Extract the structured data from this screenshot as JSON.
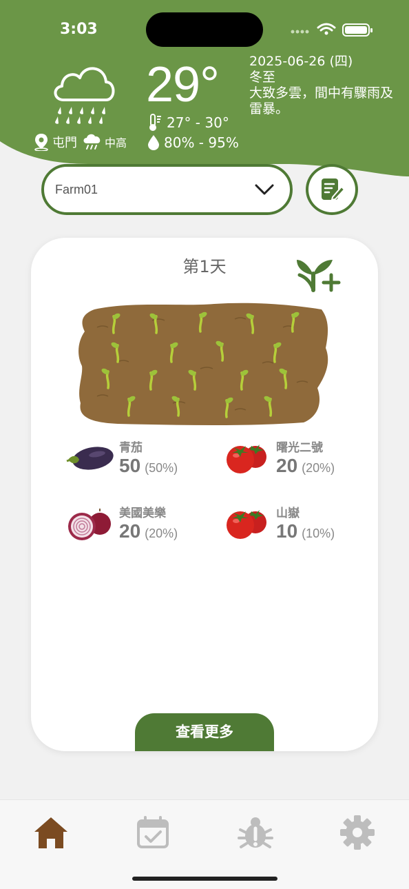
{
  "status": {
    "time": "3:03"
  },
  "weather": {
    "icon": "rain-cloud-icon",
    "location": "屯門",
    "rain_risk": "中高",
    "temperature": "29°",
    "temp_range": "27° - 30°",
    "humidity_range": "80% - 95%",
    "date": "2025-06-26 (四)",
    "solar_term": "冬至",
    "forecast": "大致多雲，間中有驟雨及雷暴。"
  },
  "farm": {
    "selected": "Farm01"
  },
  "card": {
    "day_label": "第1天",
    "crops": [
      {
        "name": "青茄",
        "count": "50",
        "percent": "(50%)",
        "icon": "eggplant-icon"
      },
      {
        "name": "曙光二號",
        "count": "20",
        "percent": "(20%)",
        "icon": "tomato-icon"
      },
      {
        "name": "美國美樂",
        "count": "20",
        "percent": "(20%)",
        "icon": "onion-icon"
      },
      {
        "name": "山嶽",
        "count": "10",
        "percent": "(10%)",
        "icon": "tomato-icon"
      }
    ],
    "more_label": "查看更多"
  },
  "colors": {
    "brand_green": "#6b9647",
    "dark_green": "#4f7a35",
    "home_brown": "#7b4b21",
    "tab_grey": "#bdbdbd"
  },
  "tabs": [
    {
      "name": "home",
      "icon": "home-icon",
      "active": true
    },
    {
      "name": "calendar",
      "icon": "calendar-check-icon",
      "active": false
    },
    {
      "name": "pest",
      "icon": "bug-icon",
      "active": false
    },
    {
      "name": "settings",
      "icon": "gear-icon",
      "active": false
    }
  ]
}
